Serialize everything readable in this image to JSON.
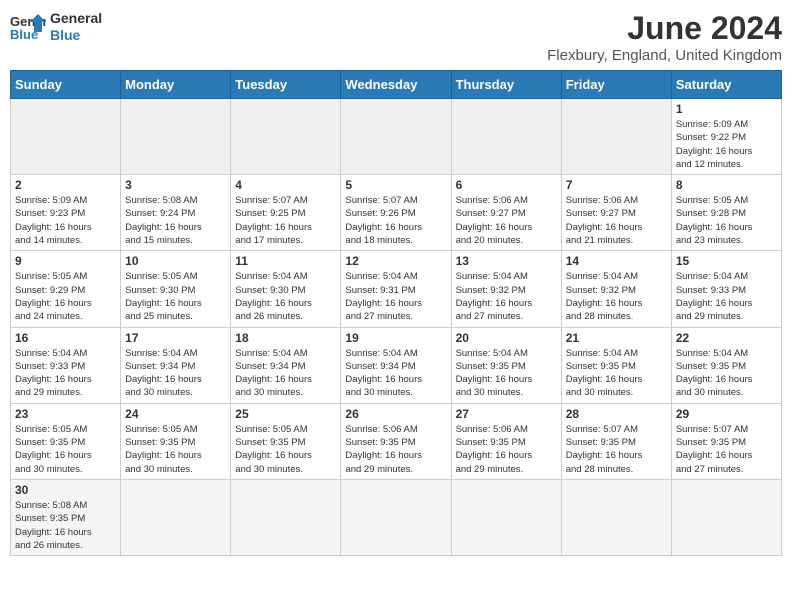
{
  "header": {
    "logo_general": "General",
    "logo_blue": "Blue",
    "month_year": "June 2024",
    "location": "Flexbury, England, United Kingdom"
  },
  "weekdays": [
    "Sunday",
    "Monday",
    "Tuesday",
    "Wednesday",
    "Thursday",
    "Friday",
    "Saturday"
  ],
  "days": {
    "d1": {
      "num": "1",
      "info": "Sunrise: 5:09 AM\nSunset: 9:22 PM\nDaylight: 16 hours\nand 12 minutes."
    },
    "d2": {
      "num": "2",
      "info": "Sunrise: 5:09 AM\nSunset: 9:23 PM\nDaylight: 16 hours\nand 14 minutes."
    },
    "d3": {
      "num": "3",
      "info": "Sunrise: 5:08 AM\nSunset: 9:24 PM\nDaylight: 16 hours\nand 15 minutes."
    },
    "d4": {
      "num": "4",
      "info": "Sunrise: 5:07 AM\nSunset: 9:25 PM\nDaylight: 16 hours\nand 17 minutes."
    },
    "d5": {
      "num": "5",
      "info": "Sunrise: 5:07 AM\nSunset: 9:26 PM\nDaylight: 16 hours\nand 18 minutes."
    },
    "d6": {
      "num": "6",
      "info": "Sunrise: 5:06 AM\nSunset: 9:27 PM\nDaylight: 16 hours\nand 20 minutes."
    },
    "d7": {
      "num": "7",
      "info": "Sunrise: 5:06 AM\nSunset: 9:27 PM\nDaylight: 16 hours\nand 21 minutes."
    },
    "d8": {
      "num": "8",
      "info": "Sunrise: 5:05 AM\nSunset: 9:28 PM\nDaylight: 16 hours\nand 23 minutes."
    },
    "d9": {
      "num": "9",
      "info": "Sunrise: 5:05 AM\nSunset: 9:29 PM\nDaylight: 16 hours\nand 24 minutes."
    },
    "d10": {
      "num": "10",
      "info": "Sunrise: 5:05 AM\nSunset: 9:30 PM\nDaylight: 16 hours\nand 25 minutes."
    },
    "d11": {
      "num": "11",
      "info": "Sunrise: 5:04 AM\nSunset: 9:30 PM\nDaylight: 16 hours\nand 26 minutes."
    },
    "d12": {
      "num": "12",
      "info": "Sunrise: 5:04 AM\nSunset: 9:31 PM\nDaylight: 16 hours\nand 27 minutes."
    },
    "d13": {
      "num": "13",
      "info": "Sunrise: 5:04 AM\nSunset: 9:32 PM\nDaylight: 16 hours\nand 27 minutes."
    },
    "d14": {
      "num": "14",
      "info": "Sunrise: 5:04 AM\nSunset: 9:32 PM\nDaylight: 16 hours\nand 28 minutes."
    },
    "d15": {
      "num": "15",
      "info": "Sunrise: 5:04 AM\nSunset: 9:33 PM\nDaylight: 16 hours\nand 29 minutes."
    },
    "d16": {
      "num": "16",
      "info": "Sunrise: 5:04 AM\nSunset: 9:33 PM\nDaylight: 16 hours\nand 29 minutes."
    },
    "d17": {
      "num": "17",
      "info": "Sunrise: 5:04 AM\nSunset: 9:34 PM\nDaylight: 16 hours\nand 30 minutes."
    },
    "d18": {
      "num": "18",
      "info": "Sunrise: 5:04 AM\nSunset: 9:34 PM\nDaylight: 16 hours\nand 30 minutes."
    },
    "d19": {
      "num": "19",
      "info": "Sunrise: 5:04 AM\nSunset: 9:34 PM\nDaylight: 16 hours\nand 30 minutes."
    },
    "d20": {
      "num": "20",
      "info": "Sunrise: 5:04 AM\nSunset: 9:35 PM\nDaylight: 16 hours\nand 30 minutes."
    },
    "d21": {
      "num": "21",
      "info": "Sunrise: 5:04 AM\nSunset: 9:35 PM\nDaylight: 16 hours\nand 30 minutes."
    },
    "d22": {
      "num": "22",
      "info": "Sunrise: 5:04 AM\nSunset: 9:35 PM\nDaylight: 16 hours\nand 30 minutes."
    },
    "d23": {
      "num": "23",
      "info": "Sunrise: 5:05 AM\nSunset: 9:35 PM\nDaylight: 16 hours\nand 30 minutes."
    },
    "d24": {
      "num": "24",
      "info": "Sunrise: 5:05 AM\nSunset: 9:35 PM\nDaylight: 16 hours\nand 30 minutes."
    },
    "d25": {
      "num": "25",
      "info": "Sunrise: 5:05 AM\nSunset: 9:35 PM\nDaylight: 16 hours\nand 30 minutes."
    },
    "d26": {
      "num": "26",
      "info": "Sunrise: 5:06 AM\nSunset: 9:35 PM\nDaylight: 16 hours\nand 29 minutes."
    },
    "d27": {
      "num": "27",
      "info": "Sunrise: 5:06 AM\nSunset: 9:35 PM\nDaylight: 16 hours\nand 29 minutes."
    },
    "d28": {
      "num": "28",
      "info": "Sunrise: 5:07 AM\nSunset: 9:35 PM\nDaylight: 16 hours\nand 28 minutes."
    },
    "d29": {
      "num": "29",
      "info": "Sunrise: 5:07 AM\nSunset: 9:35 PM\nDaylight: 16 hours\nand 27 minutes."
    },
    "d30": {
      "num": "30",
      "info": "Sunrise: 5:08 AM\nSunset: 9:35 PM\nDaylight: 16 hours\nand 26 minutes."
    }
  }
}
